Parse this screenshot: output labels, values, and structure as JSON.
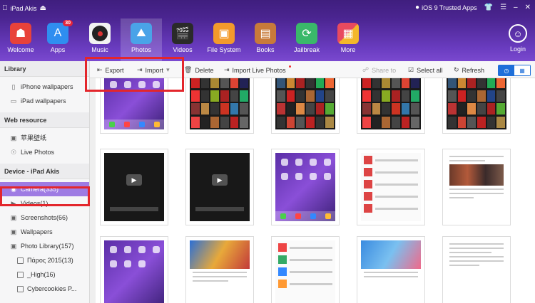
{
  "titlebar": {
    "device_name": "iPad Akis",
    "trusted_apps": "iOS 9 Trusted Apps"
  },
  "nav": {
    "items": [
      {
        "label": "Welcome",
        "icon": "store-icon",
        "color": "#e8423a"
      },
      {
        "label": "Apps",
        "icon": "app-store-icon",
        "color": "#2f8ef0",
        "badge": "30"
      },
      {
        "label": "Music",
        "icon": "music-disc-icon",
        "color": "#222222"
      },
      {
        "label": "Photos",
        "icon": "photos-icon",
        "color": "#4aa3e8"
      },
      {
        "label": "Videos",
        "icon": "clapper-icon",
        "color": "#2a2a2a"
      },
      {
        "label": "File System",
        "icon": "folder-icon",
        "color": "#f39a2b"
      },
      {
        "label": "Books",
        "icon": "books-icon",
        "color": "#c87a3a"
      },
      {
        "label": "Jailbreak",
        "icon": "jailbreak-icon",
        "color": "#3ab86a"
      },
      {
        "label": "More",
        "icon": "more-icon",
        "color": "#e84a5f"
      }
    ],
    "login_label": "Login"
  },
  "sidebar": {
    "library_title": "Library",
    "library_items": [
      "iPhone wallpapers",
      "iPad wallpapers"
    ],
    "web_title": "Web resource",
    "web_items": [
      "苹果壁纸",
      "Live Photos"
    ],
    "device_title": "Device - iPad Akis",
    "device_items": [
      "Camera(335)",
      "Videos(1)",
      "Screenshots(66)",
      "Wallpapers",
      "Photo Library(157)"
    ],
    "sub_items": [
      "Πάρος 2015(13)",
      "_High(16)",
      "Cybercookies P..."
    ]
  },
  "actions": {
    "export": "Export",
    "import": "Import",
    "delete": "Delete",
    "import_live": "Import Live Photos",
    "share": "Share to",
    "select_all": "Select all",
    "refresh": "Refresh"
  },
  "colors": {
    "accent": "#6a3cc0",
    "selected": "#9e7be3",
    "highlight": "#e3262c"
  }
}
